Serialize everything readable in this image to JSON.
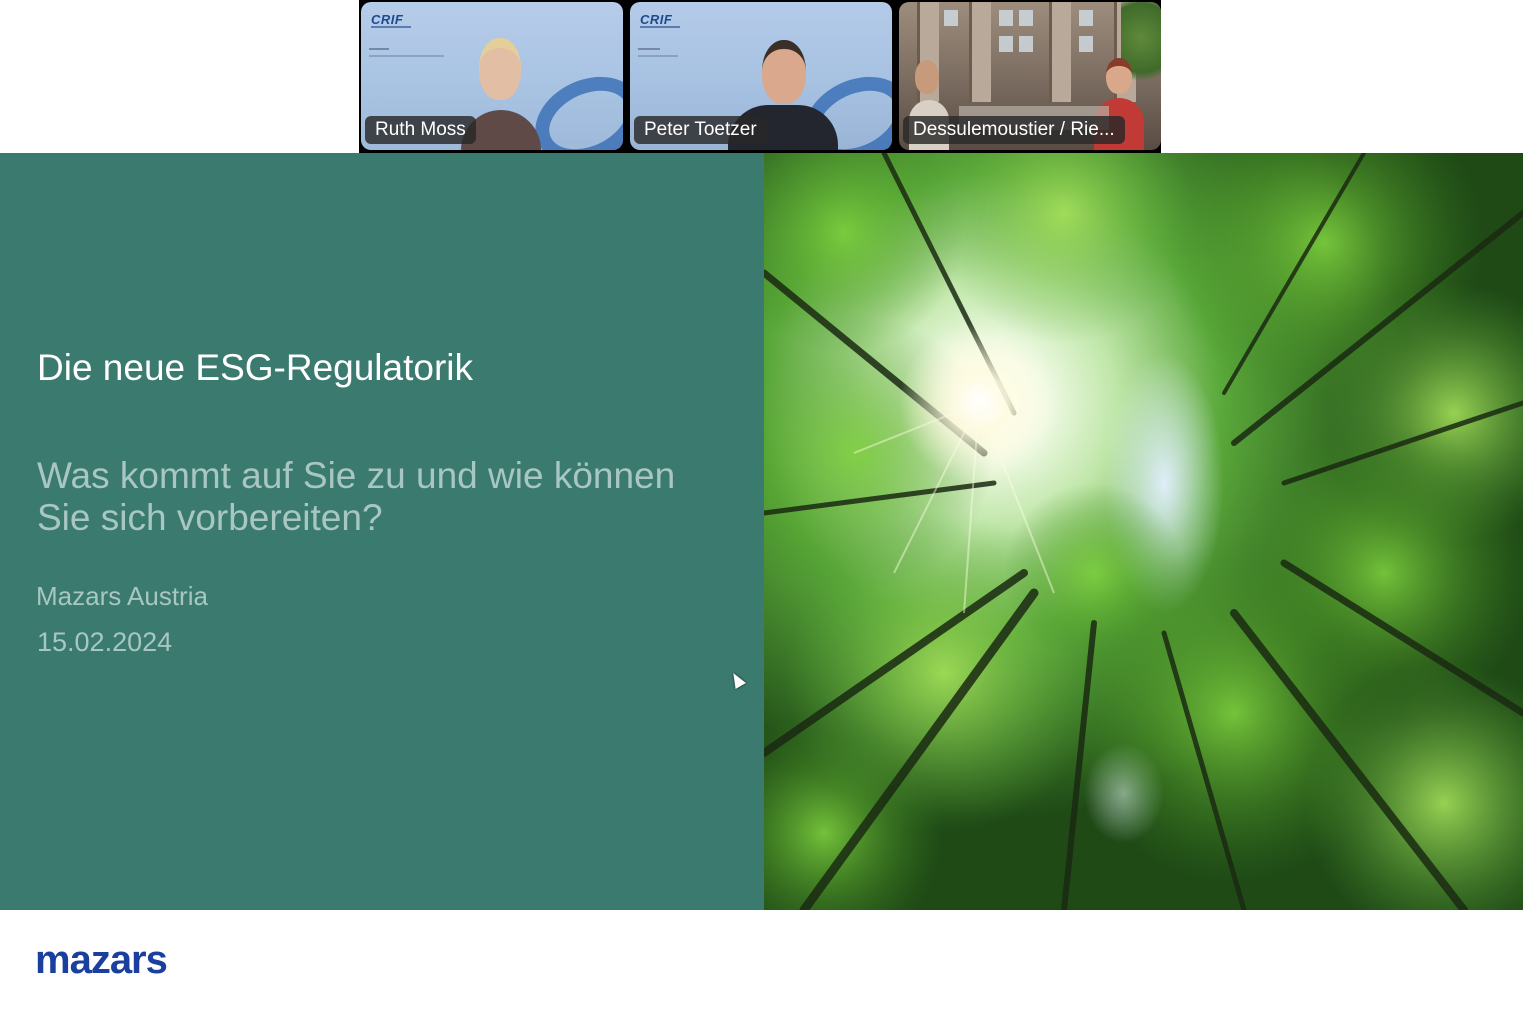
{
  "participants": [
    {
      "name": "Ruth Moss",
      "brand": "CRIF"
    },
    {
      "name": "Peter Toetzer",
      "brand": "CRIF"
    },
    {
      "name": "Dessulemoustier / Rie..."
    }
  ],
  "slide": {
    "title": "Die neue ESG-Regulatorik",
    "subtitle": "Was kommt auf Sie zu und wie können Sie sich vorbereiten?",
    "organization": "Mazars Austria",
    "date": "15.02.2024",
    "logo": "mazars",
    "panel_color": "#3a7a6f",
    "image": "forest-canopy-from-below"
  }
}
